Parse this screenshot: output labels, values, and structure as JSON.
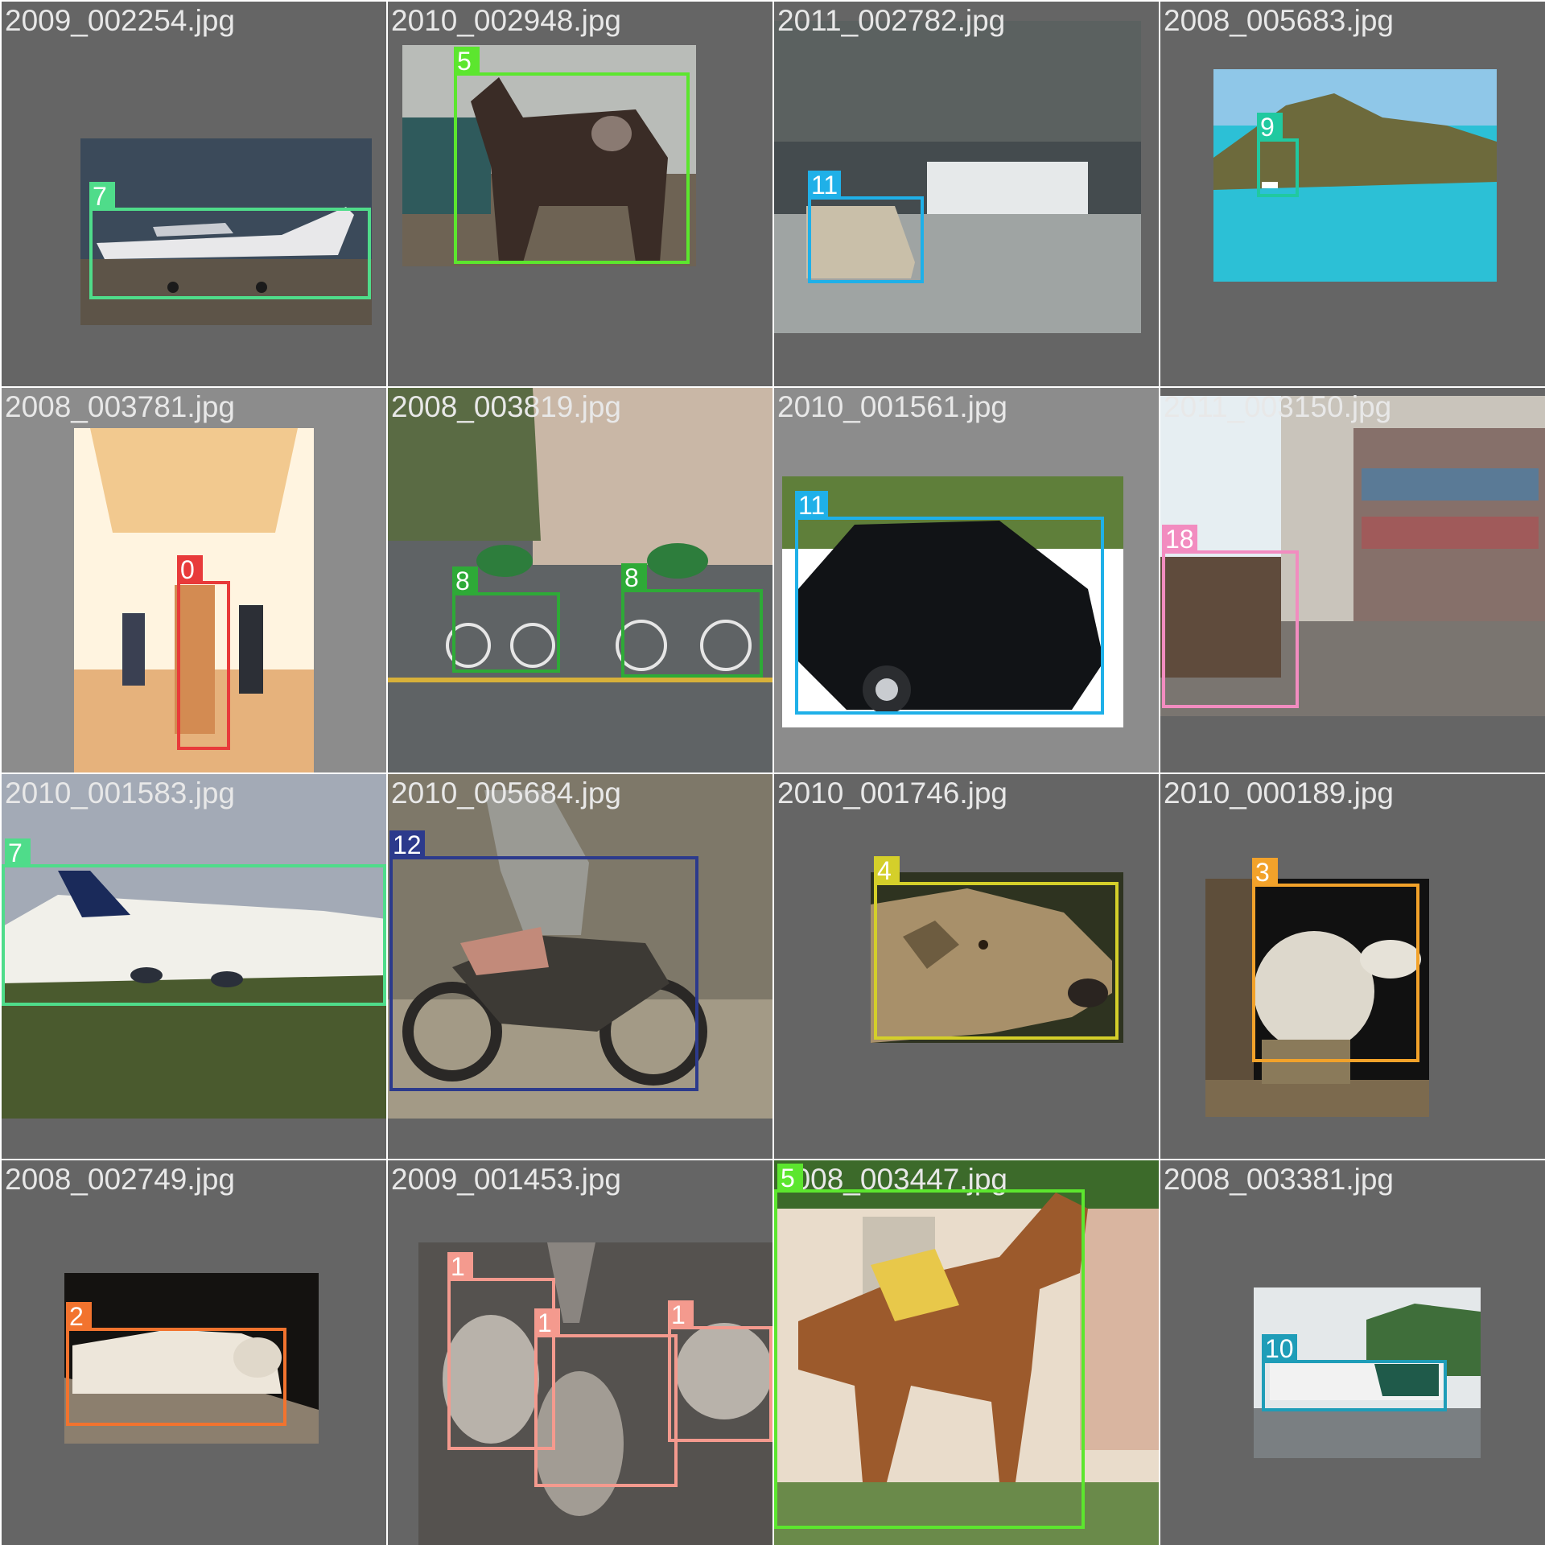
{
  "mosaic": {
    "tiles": [
      {
        "filename": "2009_002254.jpg",
        "subject": "airplane",
        "photo_palette": [
          "#3b4a5a",
          "#7d8897",
          "#5d5448"
        ],
        "boxes": [
          {
            "class_id": "7",
            "color": "#4fdc8a"
          }
        ]
      },
      {
        "filename": "2010_002948.jpg",
        "subject": "horse",
        "photo_palette": [
          "#b9bcb8",
          "#3a2c26",
          "#6e6354"
        ],
        "boxes": [
          {
            "class_id": "5",
            "color": "#5ce62e"
          }
        ]
      },
      {
        "filename": "2011_002782.jpg",
        "subject": "car",
        "photo_palette": [
          "#5b6160",
          "#9fa4a3",
          "#444b4e"
        ],
        "boxes": [
          {
            "class_id": "11",
            "color": "#1fb0e8"
          }
        ]
      },
      {
        "filename": "2008_005683.jpg",
        "subject": "boat",
        "photo_palette": [
          "#2cc0d6",
          "#6d6a3c",
          "#8fc7e8"
        ],
        "boxes": [
          {
            "class_id": "9",
            "color": "#20c9a0"
          }
        ]
      },
      {
        "filename": "2008_003781.jpg",
        "subject": "person",
        "photo_palette": [
          "#fff4e0",
          "#f2c98f",
          "#d38b52"
        ],
        "boxes": [
          {
            "class_id": "0",
            "color": "#e83a3a"
          }
        ]
      },
      {
        "filename": "2008_003819.jpg",
        "subject": "bicycle",
        "photo_palette": [
          "#5f6365",
          "#c9b7a6",
          "#2d7d3c"
        ],
        "boxes": [
          {
            "class_id": "8",
            "color": "#2eaa37"
          },
          {
            "class_id": "8",
            "color": "#2eaa37"
          }
        ]
      },
      {
        "filename": "2010_001561.jpg",
        "subject": "car",
        "photo_palette": [
          "#ffffff",
          "#111316",
          "#5f7f3a"
        ],
        "boxes": [
          {
            "class_id": "11",
            "color": "#1fb0e8"
          }
        ]
      },
      {
        "filename": "2011_003150.jpg",
        "subject": "sofa",
        "photo_palette": [
          "#c9c4bb",
          "#5f4b3c",
          "#86706a"
        ],
        "boxes": [
          {
            "class_id": "18",
            "color": "#f28cc0"
          }
        ]
      },
      {
        "filename": "2010_001583.jpg",
        "subject": "airplane",
        "photo_palette": [
          "#a3aab6",
          "#f1f0ea",
          "#4a5a2e"
        ],
        "boxes": [
          {
            "class_id": "7",
            "color": "#4fdc8a"
          }
        ]
      },
      {
        "filename": "2010_005684.jpg",
        "subject": "motorbike",
        "photo_palette": [
          "#7e7869",
          "#3d3a35",
          "#a39a86"
        ],
        "boxes": [
          {
            "class_id": "12",
            "color": "#2c3a8c"
          }
        ]
      },
      {
        "filename": "2010_001746.jpg",
        "subject": "sheep",
        "photo_palette": [
          "#2e3320",
          "#a8906a",
          "#6d5c40"
        ],
        "boxes": [
          {
            "class_id": "4",
            "color": "#d4cf2a"
          }
        ]
      },
      {
        "filename": "2010_000189.jpg",
        "subject": "sheep",
        "photo_palette": [
          "#111111",
          "#ddd8cc",
          "#7c6a4e"
        ],
        "boxes": [
          {
            "class_id": "3",
            "color": "#f2a22a"
          }
        ]
      },
      {
        "filename": "2008_002749.jpg",
        "subject": "cat",
        "photo_palette": [
          "#141210",
          "#ede6da",
          "#8c7f6e"
        ],
        "boxes": [
          {
            "class_id": "2",
            "color": "#f2732e"
          }
        ]
      },
      {
        "filename": "2009_001453.jpg",
        "subject": "bird",
        "photo_palette": [
          "#55524f",
          "#b8b2aa",
          "#8a8580"
        ],
        "boxes": [
          {
            "class_id": "1",
            "color": "#f49a8e"
          },
          {
            "class_id": "1",
            "color": "#f49a8e"
          },
          {
            "class_id": "1",
            "color": "#f49a8e"
          }
        ]
      },
      {
        "filename": "2008_003447.jpg",
        "subject": "horse",
        "photo_palette": [
          "#e9dccb",
          "#9c5a2c",
          "#3c6a2a"
        ],
        "boxes": [
          {
            "class_id": "5",
            "color": "#5ce62e"
          }
        ]
      },
      {
        "filename": "2008_003381.jpg",
        "subject": "bus",
        "photo_palette": [
          "#e4e8ea",
          "#3f6e3a",
          "#7a7f82"
        ],
        "boxes": [
          {
            "class_id": "10",
            "color": "#1f9db8"
          }
        ]
      }
    ]
  }
}
